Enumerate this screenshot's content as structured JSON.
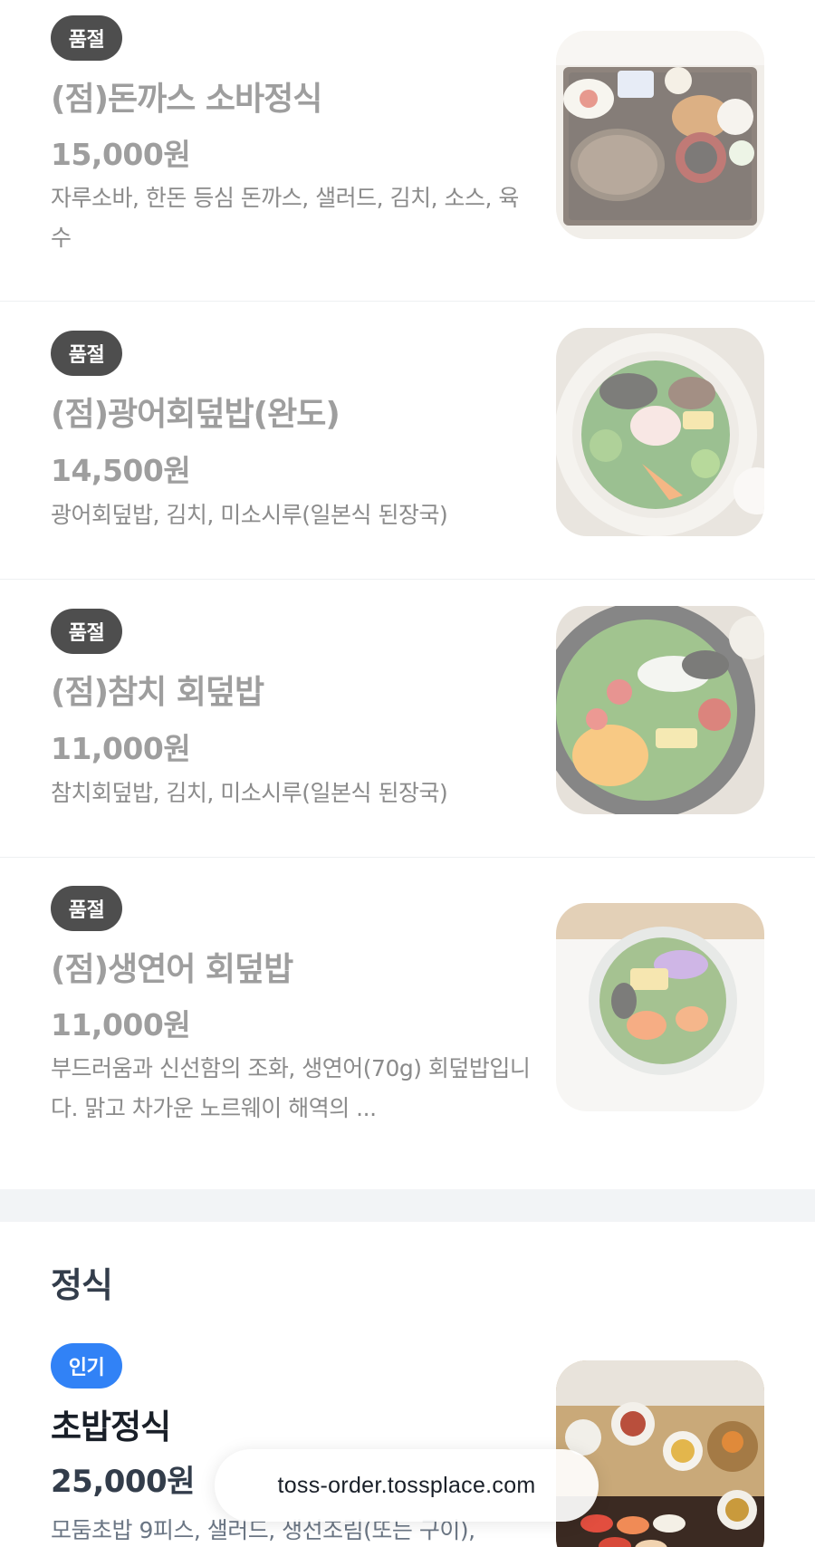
{
  "menu_items": [
    {
      "badge": "품절",
      "name": "(점)돈까스 소바정식",
      "price": "15,000원",
      "description": "자루소바, 한돈 등심 돈까스, 샐러드, 김치, 소스, 육수",
      "image_icon": "tonkatsu-soba-set-photo"
    },
    {
      "badge": "품절",
      "name": "(점)광어회덮밥(완도)",
      "price": "14,500원",
      "description": "광어회덮밥, 김치, 미소시루(일본식 된장국)",
      "image_icon": "flatfish-hoedeopbap-photo"
    },
    {
      "badge": "품절",
      "name": "(점)참치 회덮밥",
      "price": "11,000원",
      "description": "참치회덮밥, 김치, 미소시루(일본식 된장국)",
      "image_icon": "tuna-hoedeopbap-photo"
    },
    {
      "badge": "품절",
      "name": "(점)생연어 회덮밥",
      "price": "11,000원",
      "description": "부드러움과 신선함의 조화, 생연어(70g) 회덮밥입니다. 맑고 차가운 노르웨이 해역의 ...",
      "image_icon": "salmon-hoedeopbap-photo"
    }
  ],
  "section": {
    "title": "정식"
  },
  "featured_item": {
    "badge": "인기",
    "name": "초밥정식",
    "price": "25,000원",
    "description": "모둠초밥 9피스, 샐러드, 생선조림(또는 구이),",
    "image_icon": "sushi-set-photo"
  },
  "browser": {
    "url": "toss-order.tossplace.com"
  },
  "colors": {
    "soldout_badge": "#4e4e4e",
    "popular_badge": "#3182f6",
    "section_gap": "#f2f4f6"
  }
}
